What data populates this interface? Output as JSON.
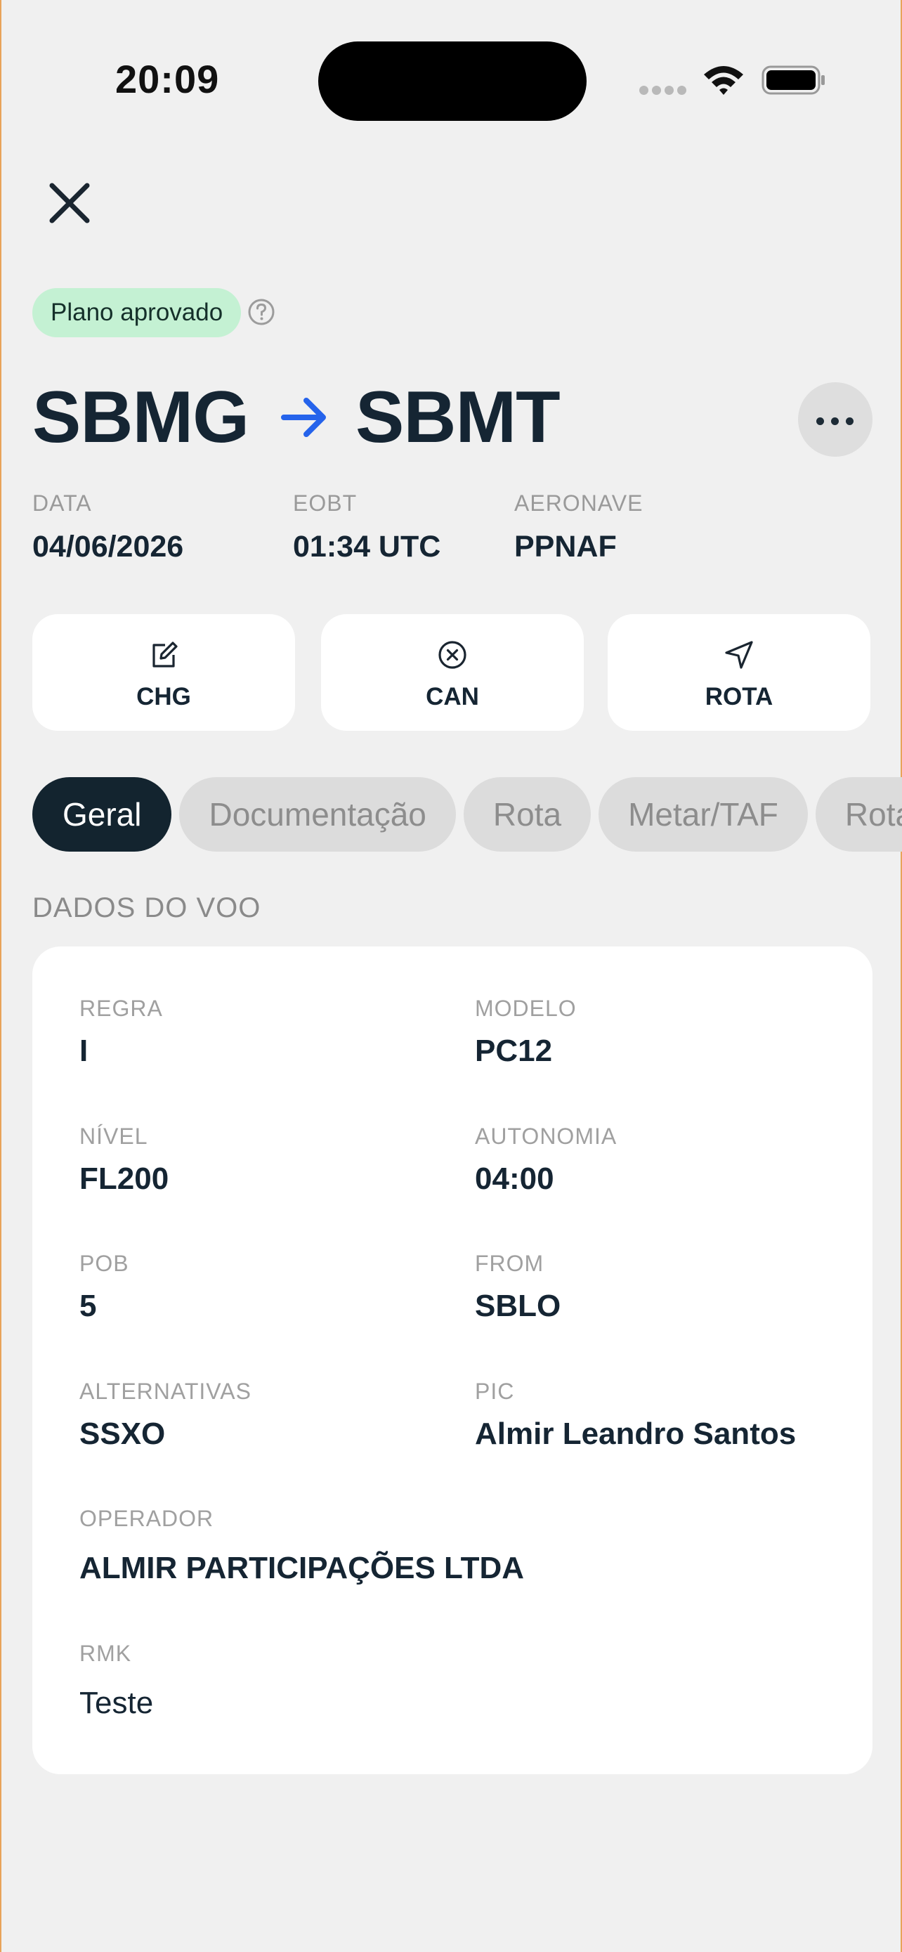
{
  "status_bar": {
    "time": "20:09"
  },
  "status_badge": "Plano aprovado",
  "route": {
    "origin": "SBMG",
    "destination": "SBMT"
  },
  "meta": [
    {
      "label": "DATA",
      "value": "04/06/2026"
    },
    {
      "label": "EOBT",
      "value": "01:34 UTC"
    },
    {
      "label": "AERONAVE",
      "value": "PPNAF"
    }
  ],
  "actions": [
    {
      "label": "CHG",
      "icon": "edit-icon"
    },
    {
      "label": "CAN",
      "icon": "cancel-circle-icon"
    },
    {
      "label": "ROTA",
      "icon": "navigation-arrow-icon"
    }
  ],
  "tabs": [
    "Geral",
    "Documentação",
    "Rota",
    "Metar/TAF",
    "Rotaer"
  ],
  "active_tab": "Geral",
  "section_title": "DADOS DO VOO",
  "flight": {
    "regra": {
      "label": "REGRA",
      "value": "I"
    },
    "modelo": {
      "label": "MODELO",
      "value": "PC12"
    },
    "nivel": {
      "label": "NÍVEL",
      "value": "FL200"
    },
    "autonomia": {
      "label": "AUTONOMIA",
      "value": "04:00"
    },
    "pob": {
      "label": "POB",
      "value": "5"
    },
    "from": {
      "label": "FROM",
      "value": "SBLO"
    },
    "alternativas": {
      "label": "ALTERNATIVAS",
      "value": "SSXO"
    },
    "pic": {
      "label": "PIC",
      "value": "Almir Leandro Santos"
    },
    "operador": {
      "label": "OPERADOR",
      "value": "ALMIR PARTICIPAÇÕES LTDA"
    },
    "rmk": {
      "label": "RMK",
      "value": "Teste"
    }
  },
  "colors": {
    "background": "#f0f0f0",
    "primary_dark": "#13242f",
    "badge_green": "#c4f1d3",
    "arrow_blue": "#2563eb"
  }
}
